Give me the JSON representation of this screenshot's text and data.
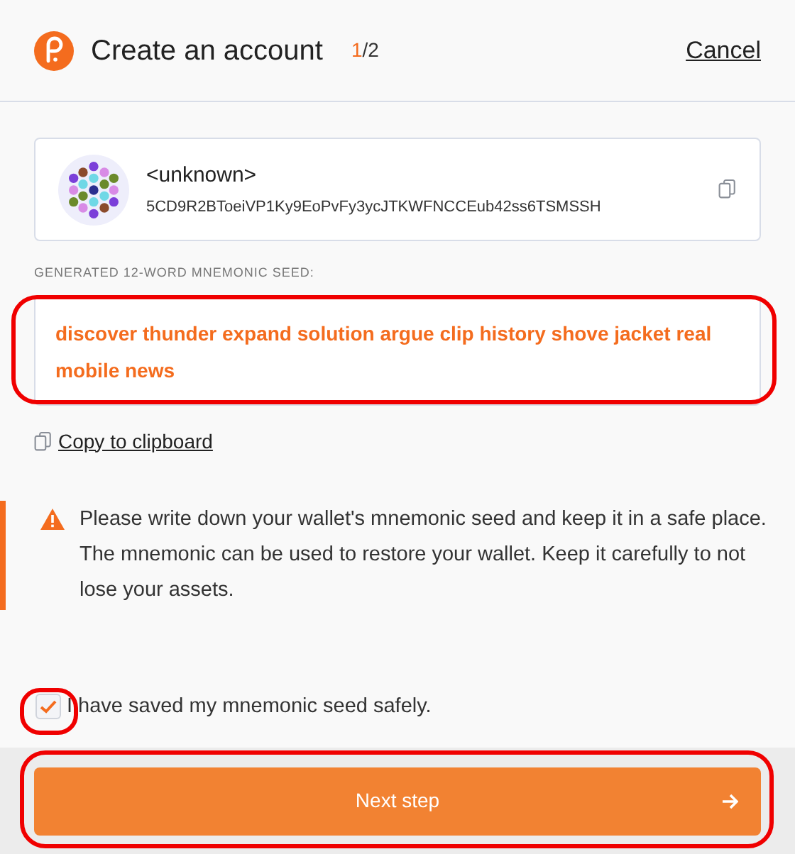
{
  "header": {
    "title": "Create an account",
    "step_current": "1",
    "step_total": "/2",
    "cancel": "Cancel"
  },
  "account": {
    "name": "<unknown>",
    "address": "5CD9R2BToeiVP1Ky9EoPvFy3ycJTKWFNCCEub42ss6TSMSSH"
  },
  "seed_label": "GENERATED 12-WORD MNEMONIC SEED:",
  "seed": "discover thunder expand solution argue clip history shove jacket real mobile news",
  "copy_link": "Copy to clipboard",
  "warning": "Please write down your wallet's mnemonic seed and keep it in a safe place. The mnemonic can be used to restore your wallet. Keep it carefully to not lose your assets.",
  "confirm": {
    "label": "I have saved my mnemonic seed safely.",
    "checked": true
  },
  "next_button": {
    "label": "Next step",
    "disabled": false
  }
}
